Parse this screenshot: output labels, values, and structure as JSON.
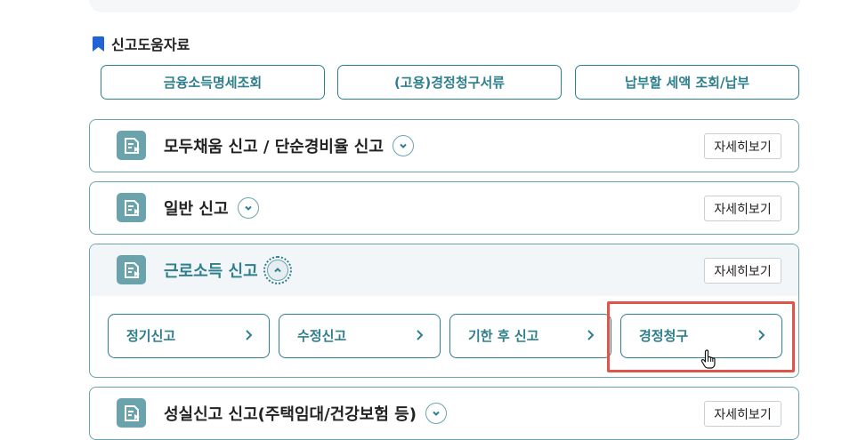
{
  "section": {
    "title": "신고도움자료",
    "buttons": [
      "금융소득명세조회",
      "(고용)경정청구서류",
      "납부할 세액 조회/납부"
    ]
  },
  "accordions": [
    {
      "title": "모두채움 신고 / 단순경비율 신고",
      "detail": "자세히보기",
      "expanded": false
    },
    {
      "title": "일반 신고",
      "detail": "자세히보기",
      "expanded": false
    },
    {
      "title": "근로소득 신고",
      "detail": "자세히보기",
      "expanded": true,
      "options": [
        "정기신고",
        "수정신고",
        "기한 후 신고",
        "경정청구"
      ]
    },
    {
      "title": "성실신고 신고(주택임대/건강보험 등)",
      "detail": "자세히보기",
      "expanded": false
    }
  ],
  "colors": {
    "accent": "#2e7f8c",
    "border": "#6aa3ac",
    "highlight": "#e0554a",
    "bookmark": "#1f63d6"
  },
  "icons": {
    "bookmark": "bookmark-icon",
    "document": "document-icon",
    "chevron": "chevron-right-icon",
    "cursor": "hand-pointer-icon"
  }
}
